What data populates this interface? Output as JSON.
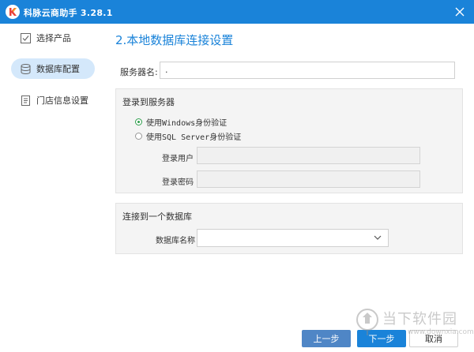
{
  "window": {
    "title": "科脉云商助手 3.28.1"
  },
  "sidebar": {
    "items": [
      {
        "label": "选择产品",
        "icon": "checkbox-icon",
        "active": false
      },
      {
        "label": "数据库配置",
        "icon": "database-icon",
        "active": true
      },
      {
        "label": "门店信息设置",
        "icon": "document-icon",
        "active": false
      }
    ]
  },
  "main": {
    "title": "2.本地数据库连接设置",
    "server": {
      "label": "服务器名:",
      "value": "."
    },
    "login_group": {
      "title": "登录到服务器",
      "auth_windows": "使用Windows身份验证",
      "auth_sql": "使用SQL Server身份验证",
      "selected_auth": "windows",
      "user_label": "登录用户",
      "password_label": "登录密码"
    },
    "db_group": {
      "title": "连接到一个数据库",
      "db_label": "数据库名称",
      "db_value": ""
    }
  },
  "footer": {
    "prev_label": "上一步",
    "next_label": "下一步",
    "cancel_label": "取消"
  },
  "watermark": {
    "text": "当下软件园",
    "url": "www.downxia.com"
  },
  "colors": {
    "accent": "#1a83d9",
    "active_nav": "#d4e8fb",
    "radio_checked": "#2e9e4c"
  }
}
